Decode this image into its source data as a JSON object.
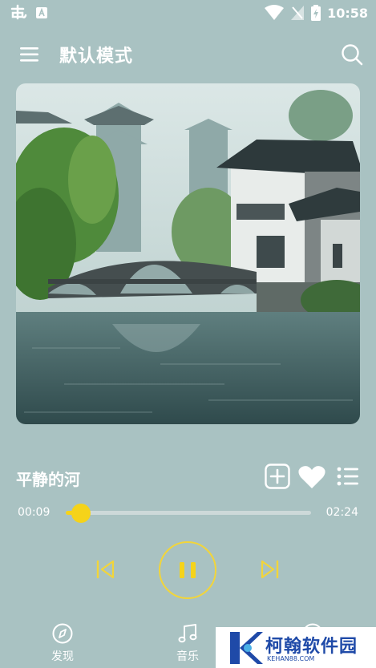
{
  "status_bar": {
    "time": "10:58",
    "left_icons": [
      "app-notification-icon",
      "font-icon"
    ],
    "right_icons": [
      "wifi-icon",
      "no-signal-icon",
      "battery-charging-icon"
    ]
  },
  "header": {
    "title": "默认模式",
    "menu_icon": "hamburger-menu-icon",
    "search_icon": "search-icon"
  },
  "player": {
    "song_title": "平静的河",
    "current_time": "00:09",
    "duration": "02:24",
    "progress_fraction": 0.0625,
    "state": "playing",
    "liked": false
  },
  "actions": [
    "add-to-playlist-icon",
    "heart-icon",
    "playlist-icon"
  ],
  "controls": [
    "previous-icon",
    "pause-icon",
    "next-icon"
  ],
  "bottom_nav": [
    {
      "label": "发现",
      "icon": "compass-icon"
    },
    {
      "label": "音乐",
      "icon": "music-note-icon"
    },
    {
      "label": "",
      "icon": "profile-icon"
    }
  ],
  "watermark": {
    "brand": "柯翰软件园",
    "url": "KEHAN88.COM"
  },
  "colors": {
    "background": "#a9c2c2",
    "accent": "#f5d31a",
    "text": "#ffffff"
  }
}
